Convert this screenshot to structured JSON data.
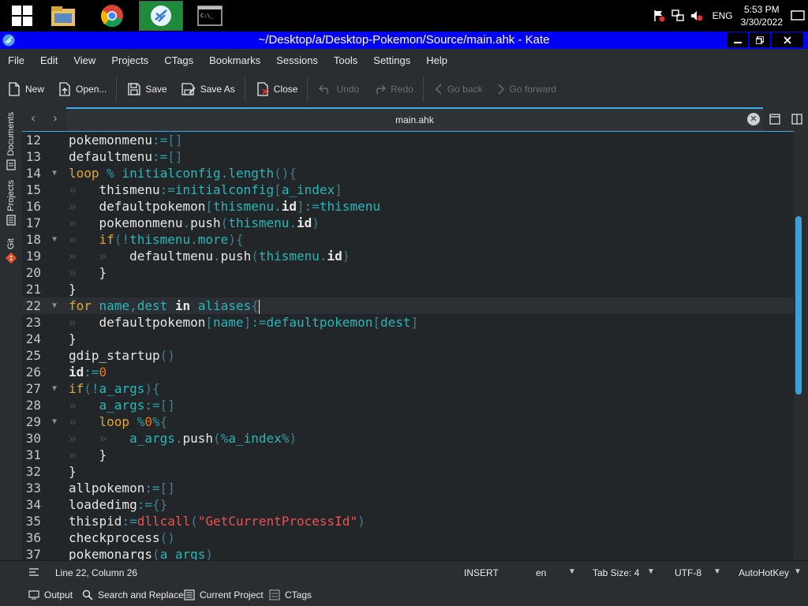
{
  "taskbar": {
    "apps": [
      {
        "name": "windows-start",
        "active": false
      },
      {
        "name": "file-explorer",
        "active": false
      },
      {
        "name": "chrome",
        "active": false
      },
      {
        "name": "kdevelop-app",
        "active": true
      },
      {
        "name": "command-prompt",
        "active": false
      }
    ],
    "tray": {
      "lang": "ENG",
      "time": "5:53 PM",
      "date": "3/30/2022"
    }
  },
  "window": {
    "title": "~/Desktop/a/Desktop-Pokemon/Source/main.ahk  - Kate"
  },
  "menu": [
    "File",
    "Edit",
    "View",
    "Projects",
    "CTags",
    "Bookmarks",
    "Sessions",
    "Tools",
    "Settings",
    "Help"
  ],
  "toolbar": {
    "new": "New",
    "open": "Open...",
    "save": "Save",
    "save_as": "Save As",
    "close": "Close",
    "undo": "Undo",
    "redo": "Redo",
    "go_back": "Go back",
    "go_forward": "Go forward"
  },
  "sidebar": {
    "documents": "Documents",
    "projects": "Projects",
    "git": "Git"
  },
  "tab": {
    "label": "main.ahk"
  },
  "editor": {
    "lines": [
      {
        "n": "12",
        "fold": "",
        "tokens": [
          [
            "def",
            "pokemonmenu"
          ],
          [
            "op",
            ":="
          ],
          [
            "br",
            "[]"
          ]
        ]
      },
      {
        "n": "13",
        "fold": "",
        "tokens": [
          [
            "def",
            "defaultmenu"
          ],
          [
            "op",
            ":="
          ],
          [
            "br",
            "[]"
          ]
        ]
      },
      {
        "n": "14",
        "fold": "▼",
        "tokens": [
          [
            "kw",
            "loop"
          ],
          [
            "def",
            " "
          ],
          [
            "op",
            "%"
          ],
          [
            "def",
            " "
          ],
          [
            "var",
            "initialconfig"
          ],
          [
            "op",
            "."
          ],
          [
            "var",
            "length"
          ],
          [
            "br",
            "(){"
          ]
        ]
      },
      {
        "n": "15",
        "fold": "",
        "tokens": [
          [
            "tab",
            "»   "
          ],
          [
            "def",
            "thismenu"
          ],
          [
            "op",
            ":="
          ],
          [
            "var",
            "initialconfig"
          ],
          [
            "br",
            "["
          ],
          [
            "var",
            "a_index"
          ],
          [
            "br",
            "]"
          ]
        ]
      },
      {
        "n": "16",
        "fold": "",
        "tokens": [
          [
            "tab",
            "»   "
          ],
          [
            "def",
            "defaultpokemon"
          ],
          [
            "br",
            "["
          ],
          [
            "var",
            "thismenu"
          ],
          [
            "op",
            "."
          ],
          [
            "bold",
            "id"
          ],
          [
            "br",
            "]"
          ],
          [
            "op",
            ":="
          ],
          [
            "var",
            "thismenu"
          ]
        ]
      },
      {
        "n": "17",
        "fold": "",
        "tokens": [
          [
            "tab",
            "»   "
          ],
          [
            "def",
            "pokemonmenu"
          ],
          [
            "op",
            "."
          ],
          [
            "def",
            "push"
          ],
          [
            "br",
            "("
          ],
          [
            "var",
            "thismenu"
          ],
          [
            "op",
            "."
          ],
          [
            "bold",
            "id"
          ],
          [
            "br",
            ")"
          ]
        ]
      },
      {
        "n": "18",
        "fold": "▼",
        "tokens": [
          [
            "tab",
            "»   "
          ],
          [
            "kw",
            "if"
          ],
          [
            "br",
            "("
          ],
          [
            "op",
            "!"
          ],
          [
            "var",
            "thismenu"
          ],
          [
            "op",
            "."
          ],
          [
            "var",
            "more"
          ],
          [
            "br",
            "){"
          ]
        ]
      },
      {
        "n": "19",
        "fold": "",
        "tokens": [
          [
            "tab",
            "»   »   "
          ],
          [
            "def",
            "defaultmenu"
          ],
          [
            "op",
            "."
          ],
          [
            "def",
            "push"
          ],
          [
            "br",
            "("
          ],
          [
            "var",
            "thismenu"
          ],
          [
            "op",
            "."
          ],
          [
            "bold",
            "id"
          ],
          [
            "br",
            ")"
          ]
        ]
      },
      {
        "n": "20",
        "fold": "",
        "tokens": [
          [
            "tab",
            "»   "
          ],
          [
            "def",
            "}"
          ]
        ]
      },
      {
        "n": "21",
        "fold": "",
        "tokens": [
          [
            "def",
            "}"
          ]
        ]
      },
      {
        "n": "22",
        "fold": "▼",
        "current": true,
        "tokens": [
          [
            "kw",
            "for"
          ],
          [
            "def",
            " "
          ],
          [
            "var",
            "name"
          ],
          [
            "op",
            ","
          ],
          [
            "var",
            "dest"
          ],
          [
            "def",
            " "
          ],
          [
            "bold",
            "in"
          ],
          [
            "def",
            " "
          ],
          [
            "var",
            "aliases"
          ],
          [
            "br",
            "{"
          ]
        ]
      },
      {
        "n": "23",
        "fold": "",
        "tokens": [
          [
            "tab",
            "»   "
          ],
          [
            "def",
            "defaultpokemon"
          ],
          [
            "br",
            "["
          ],
          [
            "var",
            "name"
          ],
          [
            "br",
            "]"
          ],
          [
            "op",
            ":="
          ],
          [
            "var",
            "defaultpokemon"
          ],
          [
            "br",
            "["
          ],
          [
            "var",
            "dest"
          ],
          [
            "br",
            "]"
          ]
        ]
      },
      {
        "n": "24",
        "fold": "",
        "tokens": [
          [
            "def",
            "}"
          ]
        ]
      },
      {
        "n": "25",
        "fold": "",
        "tokens": [
          [
            "def",
            "gdip_startup"
          ],
          [
            "br",
            "()"
          ]
        ]
      },
      {
        "n": "26",
        "fold": "",
        "tokens": [
          [
            "bold",
            "id"
          ],
          [
            "op",
            ":="
          ],
          [
            "num",
            "0"
          ]
        ]
      },
      {
        "n": "27",
        "fold": "▼",
        "tokens": [
          [
            "kw",
            "if"
          ],
          [
            "br",
            "("
          ],
          [
            "op",
            "!"
          ],
          [
            "var",
            "a_args"
          ],
          [
            "br",
            "){"
          ]
        ]
      },
      {
        "n": "28",
        "fold": "",
        "tokens": [
          [
            "tab",
            "»   "
          ],
          [
            "var",
            "a_args"
          ],
          [
            "op",
            ":="
          ],
          [
            "br",
            "[]"
          ]
        ]
      },
      {
        "n": "29",
        "fold": "▼",
        "tokens": [
          [
            "tab",
            "»   "
          ],
          [
            "kw",
            "loop"
          ],
          [
            "def",
            " "
          ],
          [
            "op",
            "%"
          ],
          [
            "num",
            "0"
          ],
          [
            "op",
            "%"
          ],
          [
            "br",
            "{"
          ]
        ]
      },
      {
        "n": "30",
        "fold": "",
        "tokens": [
          [
            "tab",
            "»   »   "
          ],
          [
            "var",
            "a_args"
          ],
          [
            "op",
            "."
          ],
          [
            "def",
            "push"
          ],
          [
            "br",
            "("
          ],
          [
            "op",
            "%"
          ],
          [
            "var",
            "a_index"
          ],
          [
            "op",
            "%"
          ],
          [
            "br",
            ")"
          ]
        ]
      },
      {
        "n": "31",
        "fold": "",
        "tokens": [
          [
            "tab",
            "»   "
          ],
          [
            "def",
            "}"
          ]
        ]
      },
      {
        "n": "32",
        "fold": "",
        "tokens": [
          [
            "def",
            "}"
          ]
        ]
      },
      {
        "n": "33",
        "fold": "",
        "tokens": [
          [
            "def",
            "allpokemon"
          ],
          [
            "op",
            ":="
          ],
          [
            "br",
            "[]"
          ]
        ]
      },
      {
        "n": "34",
        "fold": "",
        "tokens": [
          [
            "def",
            "loadedimg"
          ],
          [
            "op",
            ":="
          ],
          [
            "br",
            "{}"
          ]
        ]
      },
      {
        "n": "35",
        "fold": "",
        "tokens": [
          [
            "def",
            "thispid"
          ],
          [
            "op",
            ":="
          ],
          [
            "fn",
            "dllcall"
          ],
          [
            "br",
            "("
          ],
          [
            "str",
            "\"GetCurrentProcessId\""
          ],
          [
            "br",
            ")"
          ]
        ]
      },
      {
        "n": "36",
        "fold": "",
        "tokens": [
          [
            "def",
            "checkprocess"
          ],
          [
            "br",
            "()"
          ]
        ]
      },
      {
        "n": "37",
        "fold": "",
        "tokens": [
          [
            "def",
            "pokemonargs"
          ],
          [
            "br",
            "("
          ],
          [
            "var",
            "a_args"
          ],
          [
            "br",
            ")"
          ]
        ]
      }
    ]
  },
  "status": {
    "position": "Line 22, Column 26",
    "mode": "INSERT",
    "dictionary": "en",
    "tab_size": "Tab Size: 4",
    "encoding": "UTF-8",
    "syntax": "AutoHotKey"
  },
  "bottom": {
    "output": "Output",
    "search": "Search and Replace",
    "current_project": "Current Project",
    "ctags": "CTags"
  },
  "colors": {
    "accent": "#3daee9",
    "titlebar": "#0000f2",
    "keyword": "#e0a72c",
    "variable": "#26b7b9",
    "string": "#f44f4f",
    "number": "#f67400"
  }
}
